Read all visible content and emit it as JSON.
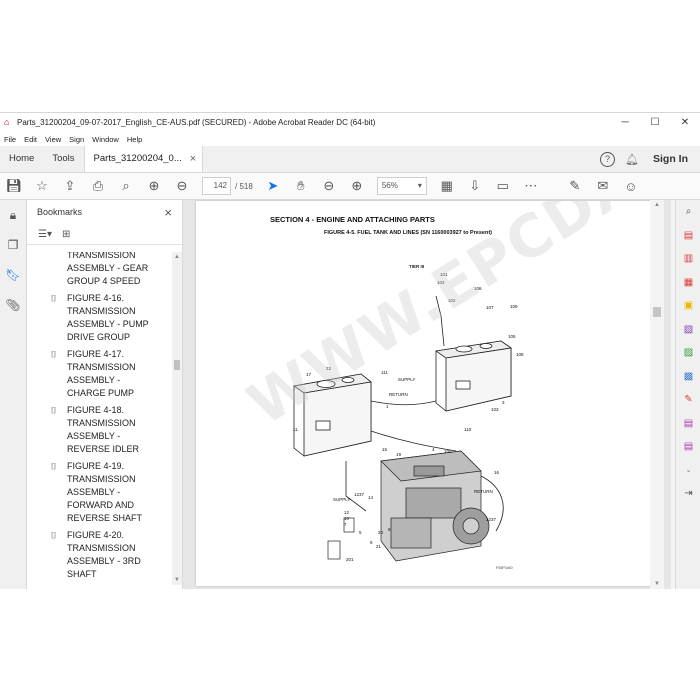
{
  "window": {
    "title": "Parts_31200204_09-07-2017_English_CE-AUS.pdf (SECURED) - Adobe Acrobat Reader DC (64-bit)",
    "controls": {
      "minimize": "─",
      "maximize": "☐",
      "close": "✕"
    }
  },
  "menu": [
    "File",
    "Edit",
    "View",
    "Sign",
    "Window",
    "Help"
  ],
  "tabs": {
    "home": "Home",
    "tools": "Tools",
    "doc": "Parts_31200204_0...",
    "doc_close": "×",
    "signin": "Sign In"
  },
  "toolbar": {
    "page_current": "142",
    "page_sep": "/",
    "page_total": "518",
    "zoom": "56%"
  },
  "bookmarks": {
    "title": "Bookmarks",
    "close": "×",
    "items": [
      {
        "label": "TRANSMISSION ASSEMBLY - GEAR GROUP 4 SPEED",
        "partial": true
      },
      {
        "label": "FIGURE 4-16. TRANSMISSION ASSEMBLY - PUMP DRIVE GROUP"
      },
      {
        "label": "FIGURE 4-17. TRANSMISSION ASSEMBLY - CHARGE PUMP"
      },
      {
        "label": "FIGURE 4-18. TRANSMISSION ASSEMBLY - REVERSE IDLER"
      },
      {
        "label": "FIGURE 4-19. TRANSMISSION ASSEMBLY - FORWARD AND REVERSE SHAFT"
      },
      {
        "label": "FIGURE 4-20. TRANSMISSION ASSEMBLY - 3RD SHAFT"
      }
    ]
  },
  "document": {
    "section_title": "SECTION 4 - ENGINE AND ATTACHING PARTS",
    "figure_title": "FIGURE 4-5. FUEL TANK AND LINES (SN 1160003927 to Present)",
    "tier": "TIER III",
    "figure_code": "FS6P3440",
    "callouts": [
      "101",
      "104",
      "106",
      "102",
      "107",
      "109",
      "108",
      "105",
      "22",
      "17",
      "111",
      "SUPPLY",
      "RETURN",
      "1",
      "3",
      "103",
      "110",
      "11",
      "15",
      "19",
      "4",
      "100",
      "16",
      "SUPPLY",
      "RETURN",
      "1237",
      "14",
      "12",
      "10",
      "7",
      "5",
      "20",
      "9",
      "21",
      "201",
      "8",
      "1237"
    ],
    "watermark": "WWW.EPCDATA.COM"
  }
}
